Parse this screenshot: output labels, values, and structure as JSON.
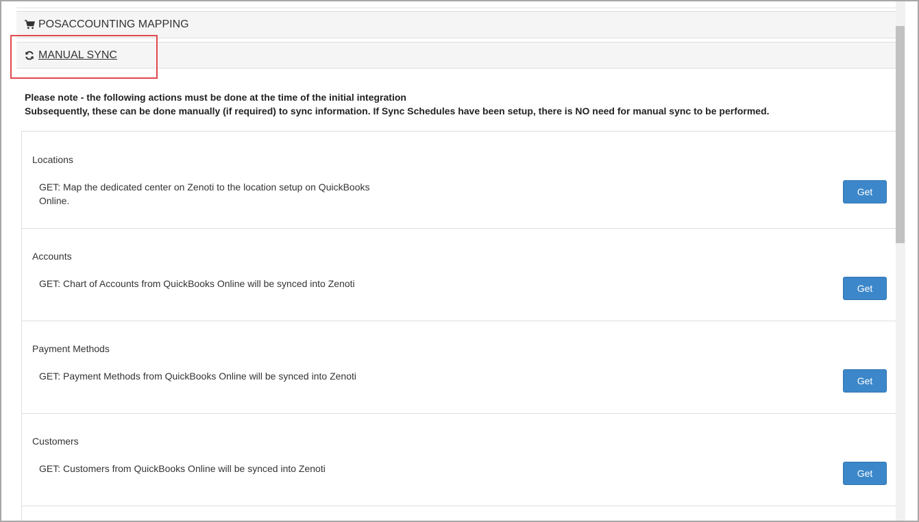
{
  "panels": {
    "posaccounting": {
      "label": "POSACCOUNTING MAPPING",
      "icon": "shopping-cart-icon"
    },
    "manual_sync": {
      "label": "MANUAL SYNC",
      "icon": "refresh-icon"
    }
  },
  "note": {
    "line1": "Please note - the following actions must be done at the time of the initial integration",
    "line2": "Subsequently, these can be done manually (if required) to sync information. If Sync Schedules have been setup, there is NO need for manual sync to be performed."
  },
  "sync_items": [
    {
      "title": "Locations",
      "description": "GET: Map the dedicated center on Zenoti to the location setup on QuickBooks Online.",
      "button": "Get"
    },
    {
      "title": "Accounts",
      "description": "GET: Chart of Accounts from QuickBooks Online will be synced into Zenoti",
      "button": "Get"
    },
    {
      "title": "Payment Methods",
      "description": "GET: Payment Methods from QuickBooks Online will be synced into Zenoti",
      "button": "Get"
    },
    {
      "title": "Customers",
      "description": "GET: Customers from QuickBooks Online will be synced into Zenoti",
      "button": "Get"
    }
  ],
  "colors": {
    "button_bg": "#3c87c9",
    "highlight": "#e0474c",
    "panel_heading_bg": "#f5f5f5"
  }
}
